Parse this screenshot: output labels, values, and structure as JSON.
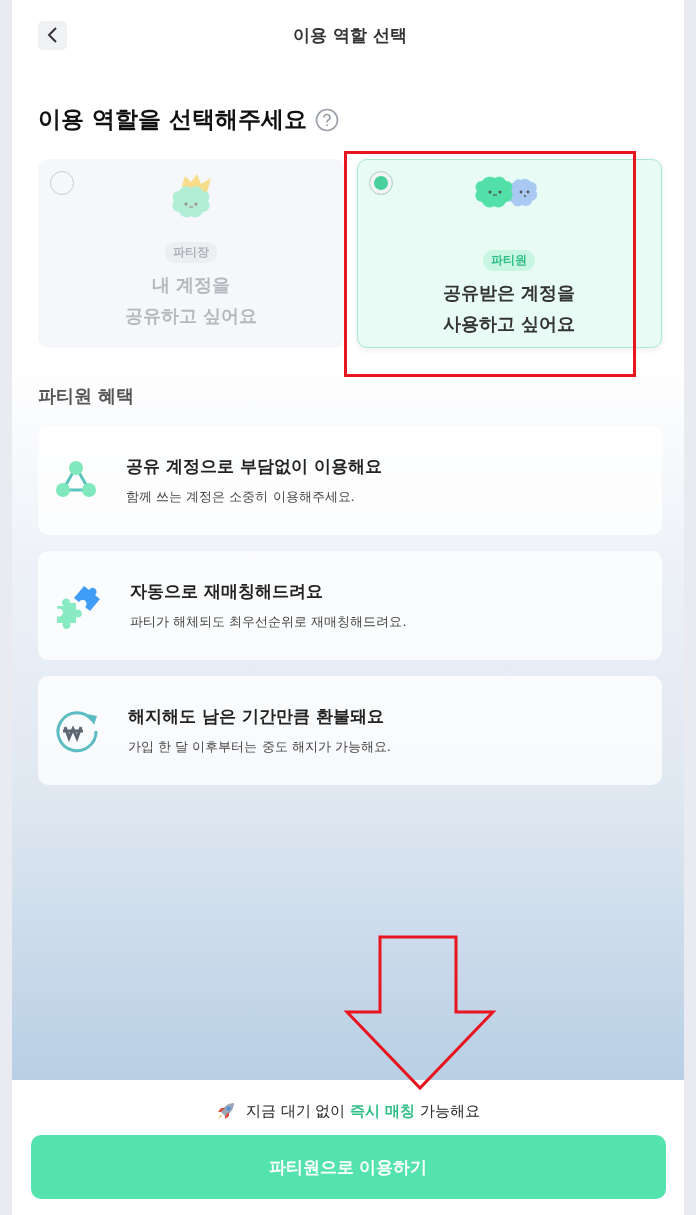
{
  "header": {
    "title": "이용 역할 선택"
  },
  "heading": "이용 역할을 선택해주세요",
  "roles": [
    {
      "kind": "leader",
      "badge": "파티장",
      "text": [
        "내 계정을",
        "공유하고 싶어요"
      ],
      "selected": false
    },
    {
      "kind": "member",
      "badge": "파티원",
      "text": [
        "공유받은 계정을",
        "사용하고 싶어요"
      ],
      "selected": true
    }
  ],
  "benefits_title": "파티원 혜택",
  "benefits": [
    {
      "kind": "share",
      "title": "공유 계정으로 부담없이 이용해요",
      "desc": "함께 쓰는 계정은 소중히 이용해주세요."
    },
    {
      "kind": "puzzle",
      "title": "자동으로 재매칭해드려요",
      "desc": "파티가 해체되도 최우선순위로 재매칭해드려요."
    },
    {
      "kind": "refund",
      "title": "해지해도 남은 기간만큼 환불돼요",
      "desc": "가입 한 달 이후부터는 중도 해지가 가능해요."
    }
  ],
  "notice": "지금 대기 없이 **즉시 매칭** 가능해요",
  "button": "파티원으로 이용하기",
  "annotations": [
    {
      "kind": "box"
    },
    {
      "kind": "arrow"
    }
  ]
}
